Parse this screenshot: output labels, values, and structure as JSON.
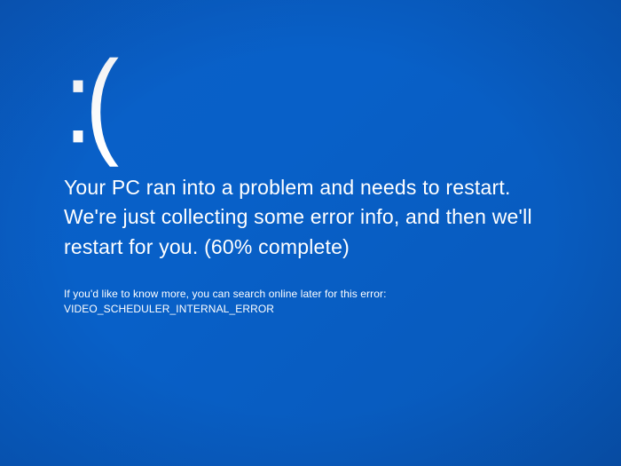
{
  "bsod": {
    "emoticon": ":(",
    "message": "Your PC ran into a problem and needs to restart. We're just collecting some error info, and then we'll restart for you. (60% complete)",
    "detail": "If you'd like to know more, you can search online later for this error: VIDEO_SCHEDULER_INTERNAL_ERROR"
  }
}
